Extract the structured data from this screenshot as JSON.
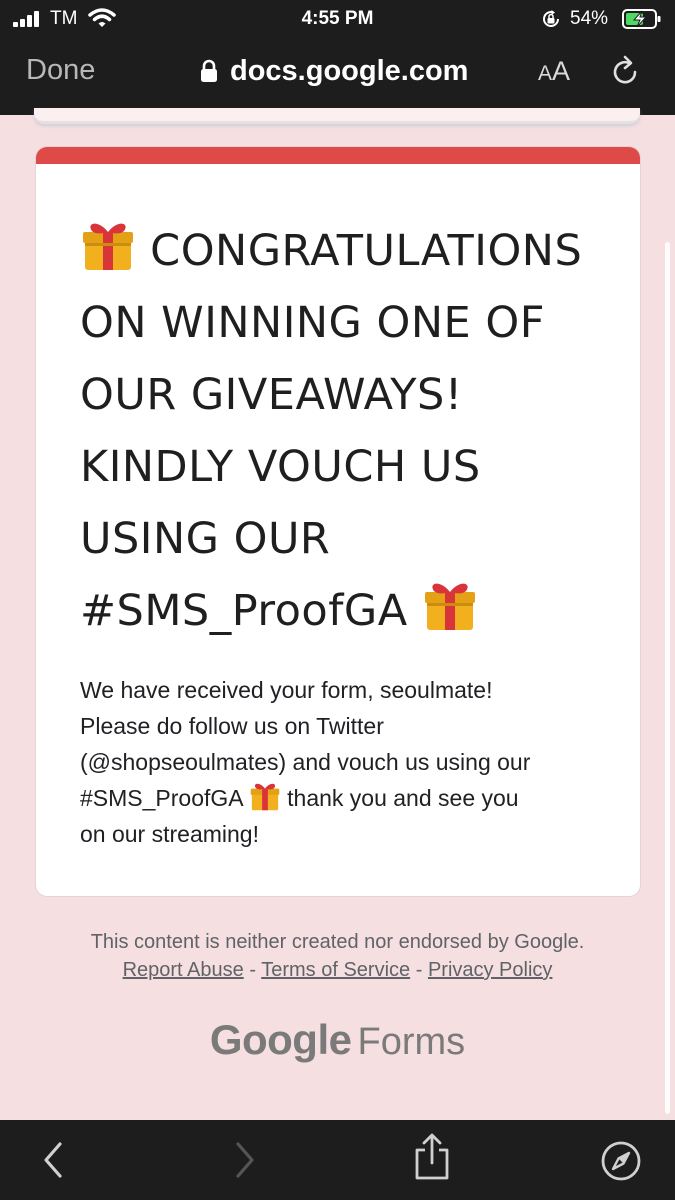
{
  "status_bar": {
    "carrier": "TM",
    "time": "4:55 PM",
    "battery_percent": "54%"
  },
  "browser": {
    "done_label": "Done",
    "url": "docs.google.com",
    "aa_small": "A",
    "aa_large": "A"
  },
  "card": {
    "accent_color": "#de4a48",
    "title_lines": [
      "CONGRATULATIONS",
      "ON WINNING ONE OF",
      "OUR GIVEAWAYS!",
      "KINDLY VOUCH US",
      "USING OUR",
      "#SMS_ProofGA"
    ],
    "body_lines": [
      "We have received your form, seoulmate!",
      "Please do follow us on Twitter",
      "(@shopseoulmates) and vouch us using our",
      "#SMS_ProofGA",
      "thank you and see you",
      "on our streaming!"
    ]
  },
  "footer": {
    "disclaimer": "This content is neither created nor endorsed by Google.",
    "report_abuse": "Report Abuse",
    "terms": "Terms of Service",
    "privacy": "Privacy Policy",
    "sep": "-",
    "brand_google": "Google",
    "brand_forms": "Forms"
  },
  "toolbar": {
    "icons": [
      "back-icon",
      "forward-icon",
      "share-icon",
      "compass-icon"
    ]
  }
}
